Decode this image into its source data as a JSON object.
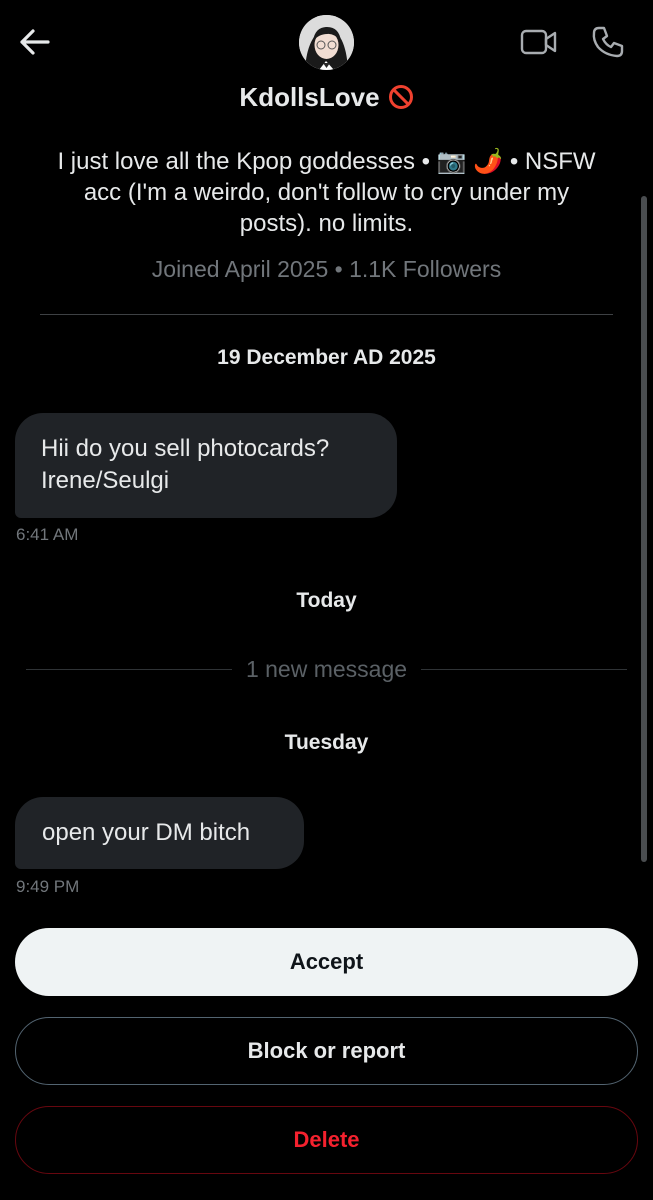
{
  "header": {
    "back_icon": "arrow-left-icon",
    "video_icon": "video-camera-icon",
    "call_icon": "phone-icon",
    "name": "KdollsLove",
    "name_badge_icon": "prohibited-icon"
  },
  "profile": {
    "bio_line1": "I just love all the Kpop goddesses • 📷 🌶️ • NSFW",
    "bio_line2": "acc (I'm a weirdo, don't follow to cry under my",
    "bio_line3": "posts). no limits.",
    "meta": "Joined April 2025 • 1.1K Followers"
  },
  "conversation": {
    "date1": "19 December AD 2025",
    "message1_line1": "Hii do you sell photocards?",
    "message1_line2": "Irene/Seulgi",
    "time1": "6:41 AM",
    "date_today": "Today",
    "new_message_label": "1 new message",
    "date_tuesday": "Tuesday",
    "message2": "open your DM bitch",
    "time2": "9:49 PM"
  },
  "actions": {
    "accept_label": "Accept",
    "block_label": "Block or report",
    "delete_label": "Delete"
  },
  "colors": {
    "background": "#000000",
    "bubble": "#202327",
    "muted_text": "#71767b",
    "accept_bg": "#eff3f4",
    "delete_red": "#f4212e"
  }
}
